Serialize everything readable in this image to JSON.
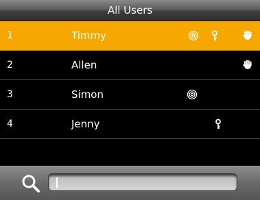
{
  "title": "All Users",
  "colors": {
    "selected_row": "#f7a800",
    "background": "#000000",
    "text": "#ffffff"
  },
  "users": [
    {
      "no": "1",
      "name": "Timmy",
      "icons": [
        "fingerprint-icon",
        "key-icon",
        "palm-icon"
      ],
      "selected": true
    },
    {
      "no": "2",
      "name": "Allen",
      "icons": [
        "palm-icon"
      ],
      "selected": false
    },
    {
      "no": "3",
      "name": "Simon",
      "icons": [
        "fingerprint-icon"
      ],
      "selected": false
    },
    {
      "no": "4",
      "name": "Jenny",
      "icons": [
        "key-icon"
      ],
      "selected": false
    }
  ],
  "search": {
    "value": "",
    "icon": "search-icon"
  }
}
